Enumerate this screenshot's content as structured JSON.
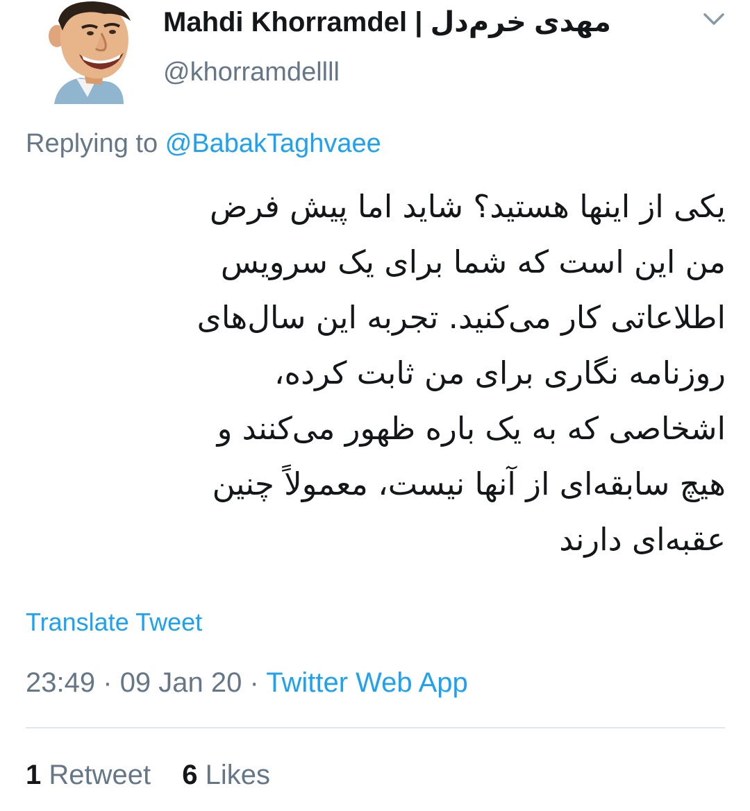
{
  "tweet": {
    "author": {
      "display_name": "Mahdi Khorramdel | مهدی خرم‌دل",
      "handle": "@khorramdellll",
      "avatar_icon": "caricature-avatar-icon"
    },
    "menu_icon": "chevron-down-icon",
    "reply": {
      "prefix": "Replying to",
      "mention": "@BabakTaghvaee"
    },
    "body_lines": [
      "یکی از اینها هستید؟ شاید اما پیش فرض",
      "من این است که شما برای یک سرویس",
      "اطلاعاتی کار می‌کنید. تجربه این سال‌های",
      "روزنامه نگاری برای من ثابت کرده،",
      "اشخاصی که به یک باره ظهور می‌کنند و",
      "هیچ سابقه‌ای از آنها نیست، معمولاً چنین",
      "عقبه‌ای دارند"
    ],
    "translate_label": "Translate Tweet",
    "time": "23:49",
    "date": "09 Jan 20",
    "separator": "·",
    "source": "Twitter Web App",
    "stats": {
      "retweets_count": "1",
      "retweets_label": "Retweet",
      "likes_count": "6",
      "likes_label": "Likes"
    },
    "colors": {
      "link": "#1da1f2",
      "secondary_text": "#657786",
      "primary_text": "#14171a",
      "divider": "#e1e8ed"
    }
  }
}
